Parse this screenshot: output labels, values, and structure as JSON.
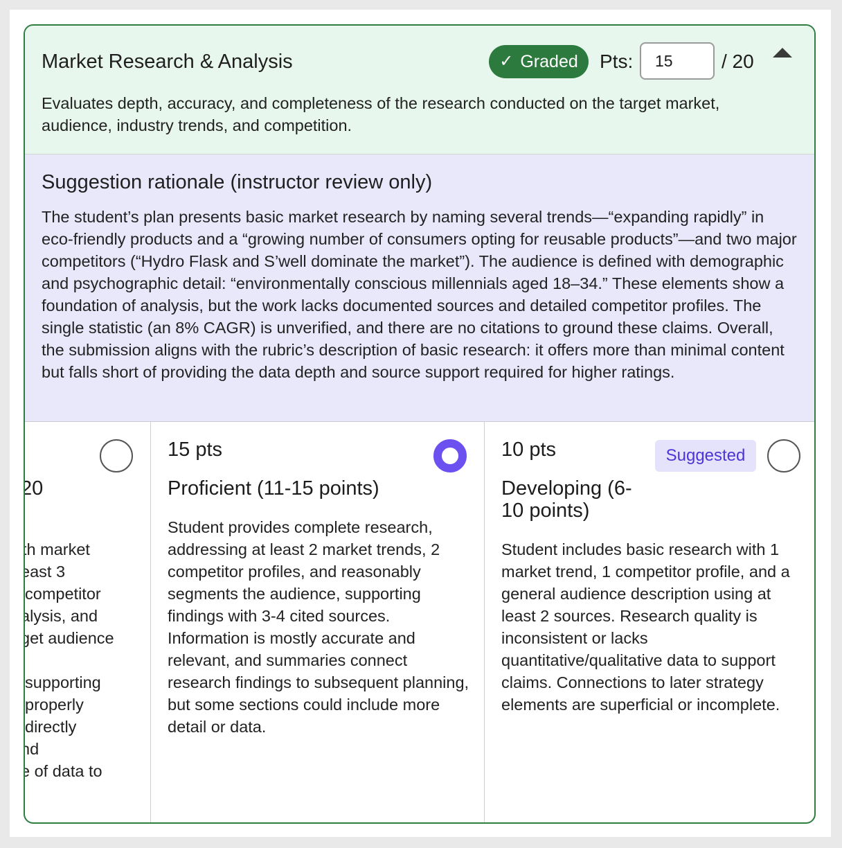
{
  "criterion": {
    "title": "Market Research & Analysis",
    "status_badge": "Graded",
    "points_label": "Pts:",
    "points_value": "15",
    "points_total": "/ 20",
    "description": "Evaluates depth, accuracy, and completeness of the research conducted on the target market, audience, industry trends, and competition."
  },
  "rationale": {
    "title": "Suggestion rationale (instructor review only)",
    "text": "The student’s plan presents basic market research by naming several trends—“expanding rapidly” in eco-friendly products and a “growing number of consumers opting for reusable products”—and two major competitors (“Hydro Flask and S’well dominate the market”). The audience is defined with demographic and psychographic detail: “environmentally conscious millennials aged 18–34.” These elements show a foundation of analysis, but the work lacks documented sources and detailed competitor profiles. The single statistic (an 8% CAGR) is unverified, and there are no citations to ground these claims. Overall, the submission aligns with the rubric’s description of basic research: it offers more than minimal content but falls short of providing the data depth and source support required for higher ratings."
  },
  "levels": {
    "partial": {
      "title_fragment": "20",
      "lines": [
        "th market",
        "east 3",
        " competitor",
        "alysis, and",
        "get audience",
        "",
        " supporting",
        " properly",
        " directly",
        "nd",
        "e of data to"
      ]
    },
    "proficient": {
      "pts": "15 pts",
      "title": "Proficient (11-15 points)",
      "description": "Student provides complete research, addressing at least 2 market trends, 2 competitor profiles, and reasonably segments the audience, supporting findings with 3-4 cited sources. Information is mostly accurate and relevant, and summaries connect research findings to subsequent planning, but some sections could include more detail or data."
    },
    "developing": {
      "pts": "10 pts",
      "suggested_label": "Suggested",
      "title": "Developing (6-10 points)",
      "description": "Student includes basic research with 1 market trend, 1 competitor profile, and a general audience description using at least 2 sources. Research quality is inconsistent or lacks quantitative/qualitative data to support claims. Connections to later strategy elements are superficial or incomplete."
    }
  },
  "colors": {
    "accent_green": "#2c7a3d",
    "selected_radio": "#6c50f0",
    "suggested_text": "#4c35d6"
  },
  "icons": {
    "badge": "check-icon",
    "header_toggle": "chevron-up-icon"
  }
}
